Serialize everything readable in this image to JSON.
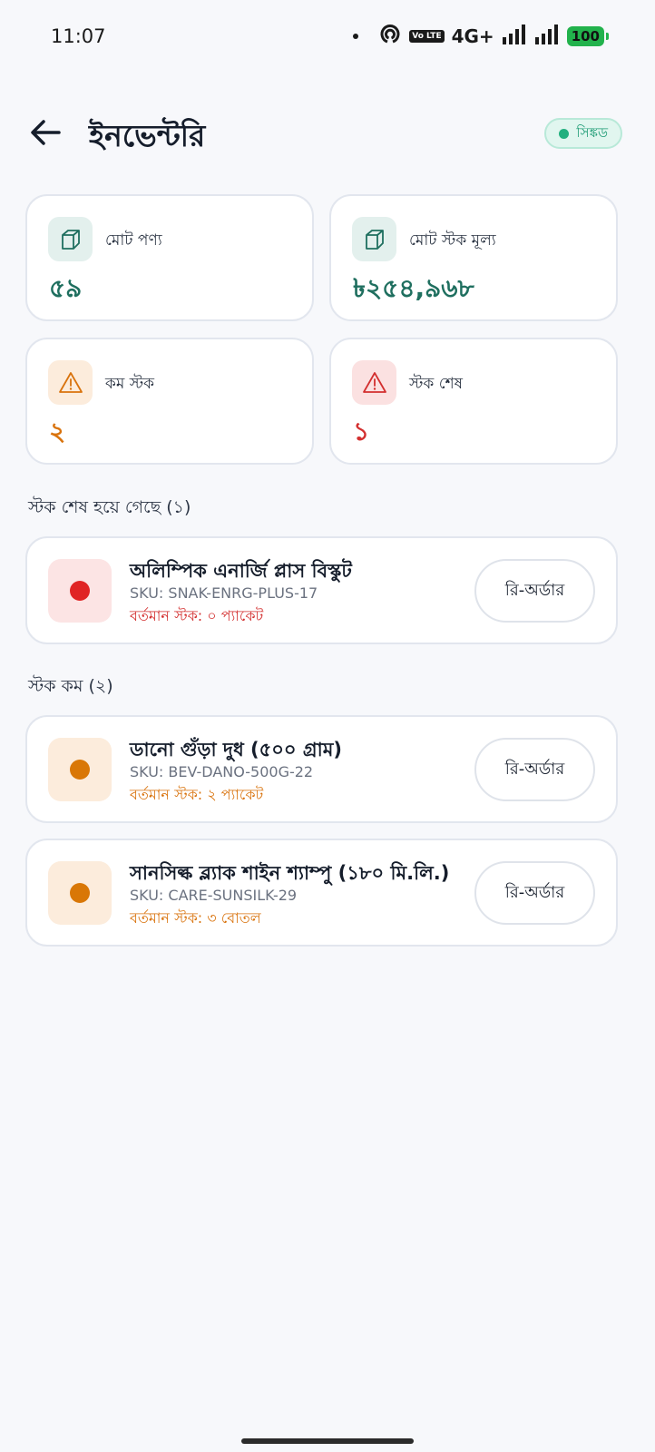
{
  "status_bar": {
    "time": "11:07",
    "volte": "Vo LTE",
    "network": "4G+",
    "battery": "100"
  },
  "header": {
    "title": "ইনভেন্টরি",
    "sync_label": "সিঙ্কড"
  },
  "stats": [
    {
      "label": "মোট পণ্য",
      "value": "৫৯",
      "icon": "box-icon",
      "color": "#1f6f5f"
    },
    {
      "label": "মোট স্টক মূল্য",
      "value": "৳২৫৪,৯৬৮",
      "icon": "box-icon",
      "color": "#1f6f5f"
    },
    {
      "label": "কম স্টক",
      "value": "২",
      "icon": "warning-icon",
      "color": "#d9730d"
    },
    {
      "label": "স্টক শেষ",
      "value": "১",
      "icon": "warning-icon",
      "color": "#d32f2f"
    }
  ],
  "sections": {
    "out_of_stock_title": "স্টক শেষ হয়ে গেছে (১)",
    "low_stock_title": "স্টক কম (২)"
  },
  "out_of_stock_items": [
    {
      "name": "অলিম্পিক এনার্জি প্লাস বিস্কুট",
      "sku": "SKU: SNAK-ENRG-PLUS-17",
      "stock": "বর্তমান স্টক: ০ প্যাকেট",
      "button": "রি-অর্ডার"
    }
  ],
  "low_stock_items": [
    {
      "name": "ডানো গুঁড়া দুধ (৫০০ গ্রাম)",
      "sku": "SKU: BEV-DANO-500G-22",
      "stock": "বর্তমান স্টক: ২ প্যাকেট",
      "button": "রি-অর্ডার"
    },
    {
      "name": "সানসিল্ক ব্ল্যাক শাইন শ্যাম্পু (১৮০ মি.লি.)",
      "sku": "SKU: CARE-SUNSILK-29",
      "stock": "বর্তমান স্টক: ৩ বোতল",
      "button": "রি-অর্ডার"
    }
  ],
  "colors": {
    "accent_green": "#1f6f5f",
    "warning_orange": "#d9730d",
    "danger_red": "#d32f2f"
  }
}
